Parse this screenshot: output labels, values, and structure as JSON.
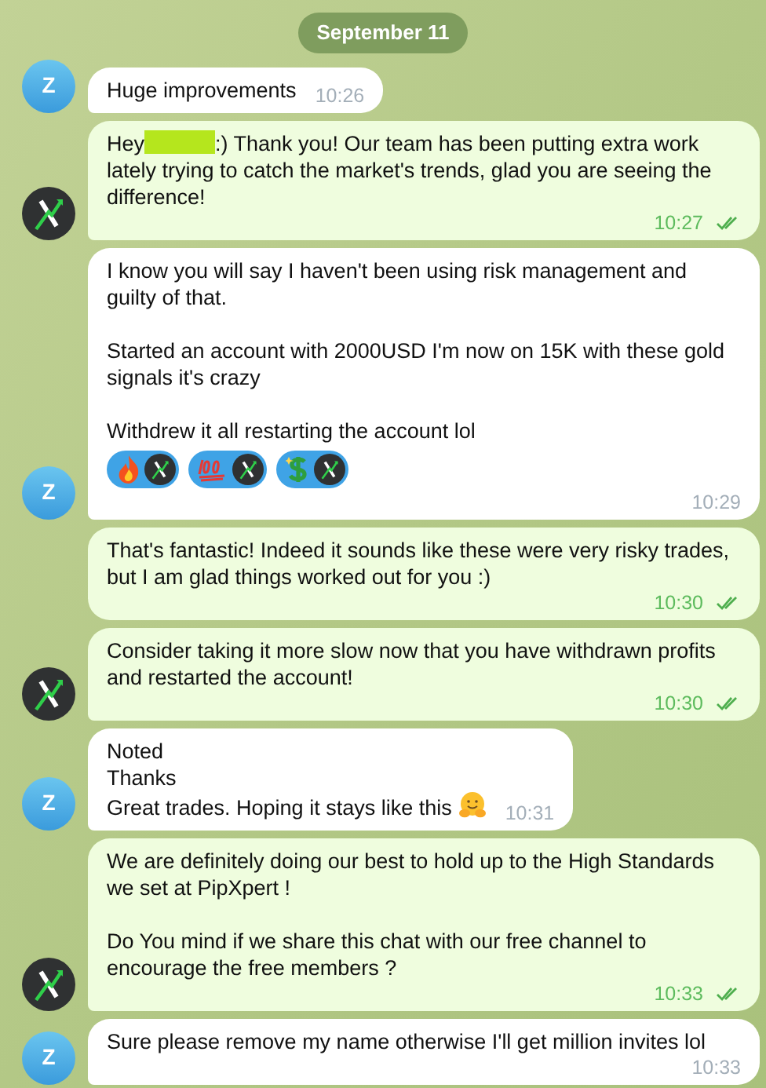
{
  "date_badge": "September 11",
  "messages": [
    {
      "kind": "incoming",
      "show_avatar": true,
      "avatar_letter": "Z",
      "paragraphs": [
        [
          "Huge improvements"
        ]
      ],
      "time": "10:26"
    },
    {
      "kind": "outgoing",
      "show_avatar": true,
      "lead": "Hey",
      "redacted": true,
      "paragraphs": [
        [
          ":) Thank you! Our team has been putting extra work lately trying to catch the market's trends, glad you are seeing the difference!"
        ]
      ],
      "time": "10:27",
      "read": true
    },
    {
      "kind": "incoming",
      "show_avatar": true,
      "avatar_letter": "Z",
      "paragraphs": [
        [
          "I know you will say I haven't been using risk management and guilty of that."
        ],
        [
          "Started an account with 2000USD I'm now on 15K with these gold signals it's crazy"
        ],
        [
          "Withdrew it all restarting the account lol"
        ]
      ],
      "reactions": [
        {
          "kind": "fire"
        },
        {
          "kind": "hundred"
        },
        {
          "kind": "dollar"
        }
      ],
      "time": "10:29"
    },
    {
      "kind": "outgoing",
      "show_avatar": false,
      "paragraphs": [
        [
          "That's fantastic! Indeed it sounds like these were very risky trades, but I am glad things worked out for you :)"
        ]
      ],
      "time": "10:30",
      "read": true
    },
    {
      "kind": "outgoing",
      "show_avatar": true,
      "paragraphs": [
        [
          "Consider taking it more slow now that you have withdrawn profits and restarted the account!"
        ]
      ],
      "time": "10:30",
      "read": true
    },
    {
      "kind": "incoming",
      "show_avatar": true,
      "avatar_letter": "Z",
      "paragraphs": [
        [
          "Noted",
          "Thanks",
          "Great trades. Hoping it stays like this"
        ]
      ],
      "trailing_emoji": {
        "kind": "hug"
      },
      "time": "10:31"
    },
    {
      "kind": "outgoing",
      "show_avatar": true,
      "paragraphs": [
        [
          "We are definitely doing our best to hold up to the High Standards we set at PipXpert !"
        ],
        [
          "Do You mind if we share this chat with our free channel to encourage the free members ?"
        ]
      ],
      "time": "10:33",
      "read": true
    },
    {
      "kind": "incoming",
      "show_avatar": true,
      "avatar_letter": "Z",
      "paragraphs": [
        [
          "Sure please remove my name otherwise I'll get million invites lol"
        ]
      ],
      "time": "10:33"
    }
  ]
}
